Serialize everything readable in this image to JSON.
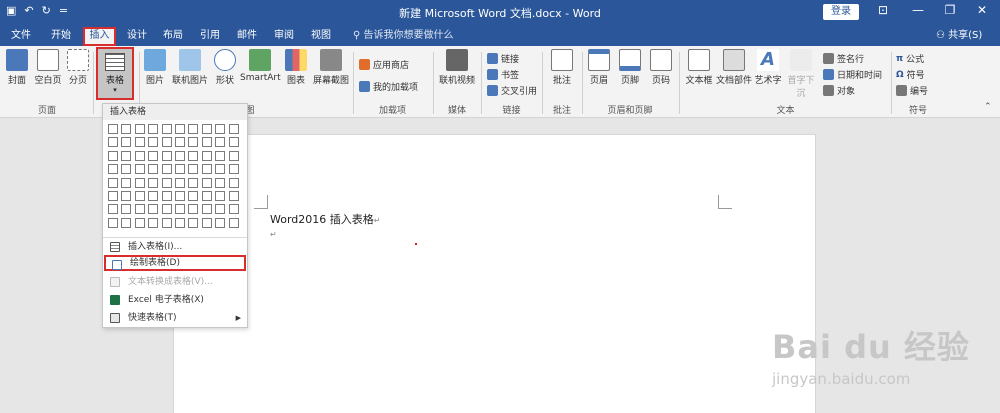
{
  "titlebar": {
    "quick_access": [
      "▣",
      "↶",
      "↻",
      "="
    ],
    "title": "新建 Microsoft Word 文档.docx - Word",
    "login_label": "登录",
    "controls": [
      "⊡",
      "—",
      "❐",
      "✕"
    ]
  },
  "tabs": {
    "items": [
      "文件",
      "开始",
      "插入",
      "设计",
      "布局",
      "引用",
      "邮件",
      "审阅",
      "视图"
    ],
    "active": "插入",
    "tell_me": "告诉我你想要做什么",
    "share": "共享(S)"
  },
  "ribbon": {
    "pages_group": {
      "label": "页面",
      "buttons": [
        "封面",
        "空白页",
        "分页"
      ]
    },
    "table_button": "表格",
    "illustrations": [
      "图片",
      "联机图片",
      "形状",
      "SmartArt",
      "图表",
      "屏幕截图"
    ],
    "illustrations_label": "图",
    "addins": {
      "label": "加载项",
      "items": [
        "应用商店",
        "我的加载项"
      ]
    },
    "media": {
      "label": "媒体",
      "button": "联机视频"
    },
    "links": {
      "label": "链接",
      "items": [
        "链接",
        "书签",
        "交叉引用"
      ]
    },
    "comments": {
      "label": "批注",
      "button": "批注"
    },
    "header_footer": {
      "label": "页眉和页脚",
      "buttons": [
        "页眉",
        "页脚",
        "页码"
      ]
    },
    "text": {
      "label": "文本",
      "buttons": [
        "文本框",
        "文档部件",
        "艺术字",
        "首字下沉"
      ],
      "small": [
        "签名行",
        "日期和时间",
        "对象"
      ]
    },
    "symbols": {
      "label": "符号",
      "items": [
        "公式",
        "符号",
        "编号"
      ]
    }
  },
  "dropdown": {
    "header": "插入表格",
    "grid_cols": 10,
    "grid_rows": 8,
    "items": [
      {
        "label": "插入表格(I)...",
        "enabled": true,
        "icon": "table-icon"
      },
      {
        "label": "绘制表格(D)",
        "enabled": true,
        "icon": "pencil-icon",
        "highlighted": true
      },
      {
        "label": "文本转换成表格(V)...",
        "enabled": false,
        "icon": "convert-icon"
      },
      {
        "label": "Excel 电子表格(X)",
        "enabled": true,
        "icon": "excel-icon"
      },
      {
        "label": "快速表格(T)",
        "enabled": true,
        "icon": "quick-table-icon",
        "submenu": true
      }
    ]
  },
  "document": {
    "line1": "Word2016 插入表格",
    "para_mark": "↵"
  },
  "watermark": {
    "brand": "Bai du 经验",
    "url": "jingyan.baidu.com"
  },
  "colors": {
    "title_blue": "#2b579a",
    "highlight_red": "#d72d2d",
    "ribbon_bg": "#f3f3f3"
  }
}
